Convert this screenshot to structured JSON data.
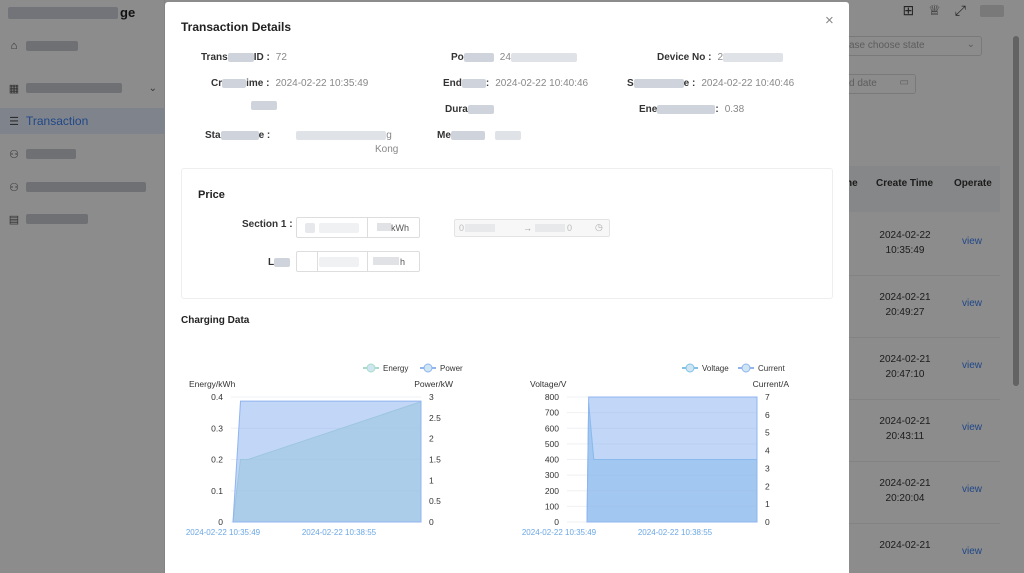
{
  "app": {
    "logo_tail": "ge",
    "nav": [
      {
        "label": ""
      },
      {
        "label": ""
      },
      {
        "label": "Transaction"
      },
      {
        "label": ""
      },
      {
        "label": ""
      },
      {
        "label": ""
      }
    ]
  },
  "background": {
    "state_placeholder": "ase choose state",
    "date_placeholder": "d date",
    "table_headers": {
      "c1": "ne",
      "create_time": "Create Time",
      "operate": "Operate"
    },
    "rows": [
      {
        "date": "2024-02-22",
        "time": "10:35:49",
        "action": "view"
      },
      {
        "date": "2024-02-21",
        "time": "20:49:27",
        "action": "view"
      },
      {
        "date": "2024-02-21",
        "time": "20:47:10",
        "action": "view"
      },
      {
        "date": "2024-02-21",
        "time": "20:43:11",
        "action": "view"
      },
      {
        "date": "2024-02-21",
        "time": "20:20:04",
        "action": "view"
      },
      {
        "date": "2024-02-21",
        "time": "",
        "action": "view"
      }
    ]
  },
  "modal": {
    "title": "Transaction Details",
    "close": "×",
    "fields": {
      "transaction_id": {
        "label_tail": "ID :",
        "value": "72"
      },
      "port": {
        "label_head": "Po",
        "value": "24"
      },
      "device_no": {
        "label": "Device No :",
        "value": "2"
      },
      "create_time": {
        "label_head": "Cr",
        "label_tail": "ime :",
        "value": "2024-02-22 10:35:49"
      },
      "end_time": {
        "label_head": "End",
        "label_tail": ":",
        "value": "2024-02-22 10:40:46"
      },
      "third_time": {
        "label_head": "S",
        "label_tail": "e :",
        "value": "2024-02-22 10:40:46"
      },
      "duration": {
        "label_head": "Dura",
        "value": ""
      },
      "energy_usage": {
        "label_head": "Ene",
        "label_tail": ":",
        "value": "0.38"
      },
      "station_name": {
        "label_head": "Sta",
        "label_tail": "e :",
        "value_tail": "g",
        "value_line2": "Kong"
      },
      "method": {
        "label_head": "Me",
        "value": ""
      }
    },
    "price": {
      "title": "Price",
      "section_label": "Section 1 :",
      "unit1": "kWh",
      "unit2": "h",
      "time_start": "0",
      "time_sep": "→",
      "time_end": "0"
    },
    "charging_title": "Charging Data"
  },
  "colors": {
    "energy": "#a8dcc8",
    "power": "#8fb4f0",
    "voltage": "#7fc2e6",
    "current": "#8fb4f0",
    "accent": "#3b82f6"
  },
  "chart_data": [
    {
      "type": "area",
      "legend": [
        "Energy",
        "Power"
      ],
      "ylabel_left": "Energy/kWh",
      "ylabel_right": "Power/kW",
      "left_ticks": [
        "0.4",
        "0.3",
        "0.2",
        "0.1",
        "0"
      ],
      "right_ticks": [
        "3",
        "2.5",
        "2",
        "1.5",
        "1",
        "0.5",
        "0"
      ],
      "x_ticks": [
        "2024-02-22 10:35:49",
        "2024-02-22 10:38:55"
      ],
      "ylim_left": [
        0,
        0.4
      ],
      "ylim_right": [
        0,
        3
      ],
      "series": [
        {
          "name": "Energy",
          "axis": "left",
          "x": [
            0,
            0.04,
            0.08,
            1
          ],
          "values": [
            0,
            0.2,
            0.2,
            0.385
          ]
        },
        {
          "name": "Power",
          "axis": "right",
          "x": [
            0,
            0.04,
            0.06,
            1
          ],
          "values": [
            0,
            2.9,
            2.9,
            2.9
          ]
        }
      ]
    },
    {
      "type": "area",
      "legend": [
        "Voltage",
        "Current"
      ],
      "ylabel_left": "Voltage/V",
      "ylabel_right": "Current/A",
      "left_ticks": [
        "800",
        "700",
        "600",
        "500",
        "400",
        "300",
        "200",
        "100",
        "0"
      ],
      "right_ticks": [
        "7",
        "6",
        "5",
        "4",
        "3",
        "2",
        "1",
        "0"
      ],
      "x_ticks": [
        "2024-02-22 10:35:49",
        "2024-02-22 10:38:55"
      ],
      "ylim_left": [
        0,
        800
      ],
      "ylim_right": [
        0,
        7
      ],
      "series": [
        {
          "name": "Voltage",
          "axis": "left",
          "x": [
            0,
            0.01,
            0.04,
            1
          ],
          "values": [
            0,
            760,
            400,
            400
          ]
        },
        {
          "name": "Current",
          "axis": "right",
          "x": [
            0,
            0.01,
            0.02,
            1
          ],
          "values": [
            0,
            7,
            7,
            7
          ]
        }
      ]
    }
  ]
}
